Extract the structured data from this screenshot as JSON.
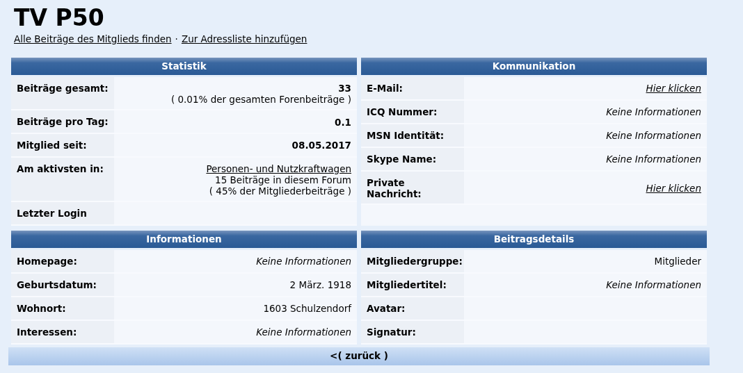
{
  "title": "TV P50",
  "links": [
    "Alle Beiträge des Mitglieds finden",
    "Zur Adressliste hinzufügen"
  ],
  "link_separator": "·",
  "panels": [
    {
      "title": "Statistik",
      "rows": [
        {
          "label": "Beiträge gesamt:",
          "values": [
            {
              "kind": "bold",
              "text": "33"
            },
            {
              "kind": "plain",
              "text": "( 0.01% der gesamten Forenbeiträge )"
            }
          ]
        },
        {
          "label": "Beiträge pro Tag:",
          "values": [
            {
              "kind": "bold",
              "text": "0.1"
            }
          ]
        },
        {
          "label": "Mitglied seit:",
          "values": [
            {
              "kind": "bold",
              "text": "08.05.2017"
            }
          ]
        },
        {
          "label": "Am aktivsten in:",
          "values": [
            {
              "kind": "link",
              "text": "Personen- und Nutzkraftwagen"
            },
            {
              "kind": "plain",
              "text": "15 Beiträge in diesem Forum"
            },
            {
              "kind": "plain",
              "text": "( 45% der Mitgliederbeiträge )"
            }
          ]
        },
        {
          "label": "Letzter Login"
        }
      ]
    },
    {
      "title": "Kommunikation",
      "rows": [
        {
          "label": "E-Mail:",
          "values": [
            {
              "kind": "italic-link",
              "text": "Hier klicken"
            }
          ]
        },
        {
          "label": "ICQ Nummer:",
          "values": [
            {
              "kind": "italic",
              "text": "Keine Informationen"
            }
          ]
        },
        {
          "label": "MSN Identität:",
          "values": [
            {
              "kind": "italic",
              "text": "Keine Informationen"
            }
          ]
        },
        {
          "label": "Skype Name:",
          "values": [
            {
              "kind": "italic",
              "text": "Keine Informationen"
            }
          ]
        },
        {
          "label": "Private Nachricht:",
          "values": [
            {
              "kind": "italic-link",
              "text": "Hier klicken"
            }
          ]
        }
      ]
    },
    {
      "title": "Informationen",
      "rows": [
        {
          "label": "Homepage:",
          "values": [
            {
              "kind": "italic",
              "text": "Keine Informationen"
            }
          ]
        },
        {
          "label": "Geburtsdatum:",
          "values": [
            {
              "kind": "plain",
              "text": "2 März. 1918"
            }
          ]
        },
        {
          "label": "Wohnort:",
          "values": [
            {
              "kind": "plain",
              "text": "1603 Schulzendorf"
            }
          ]
        },
        {
          "label": "Interessen:",
          "values": [
            {
              "kind": "italic",
              "text": "Keine Informationen"
            }
          ]
        }
      ]
    },
    {
      "title": "Beitragsdetails",
      "rows": [
        {
          "label": "Mitgliedergruppe:",
          "values": [
            {
              "kind": "plain",
              "text": "Mitglieder"
            }
          ]
        },
        {
          "label": "Mitgliedertitel:",
          "values": [
            {
              "kind": "italic",
              "text": "Keine Informationen"
            }
          ]
        },
        {
          "label": "Avatar:"
        },
        {
          "label": "Signatur:"
        }
      ]
    }
  ],
  "back_link": "<( zurück )"
}
